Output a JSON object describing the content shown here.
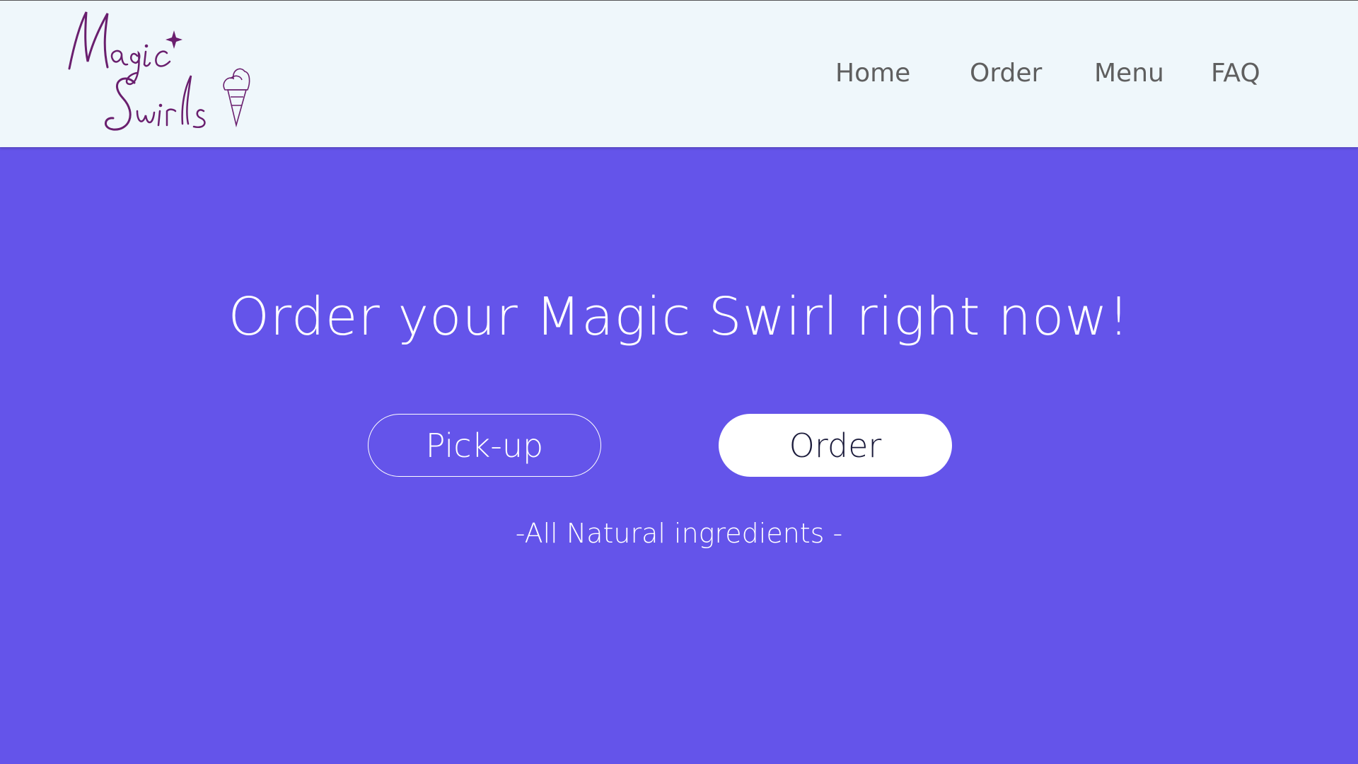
{
  "brand": {
    "logo_text_line1": "Magic",
    "logo_text_line2": "Swirls",
    "logo_color": "#6a1f6e"
  },
  "nav": {
    "items": [
      {
        "label": "Home"
      },
      {
        "label": "Order"
      },
      {
        "label": "Menu"
      },
      {
        "label": "FAQ"
      }
    ]
  },
  "hero": {
    "title": "Order your Magic Swirl right now!",
    "buttons": {
      "pickup_label": "Pick-up",
      "order_label": "Order"
    },
    "tagline": "-All Natural ingredients -"
  },
  "colors": {
    "background": "#6454ea",
    "header_bg": "#eff7fb",
    "nav_text": "#5f5f5f",
    "order_button_text": "#1c1c3c"
  },
  "icons": {
    "sparkle": "sparkle-icon",
    "ice_cream": "ice-cream-cone-icon"
  }
}
